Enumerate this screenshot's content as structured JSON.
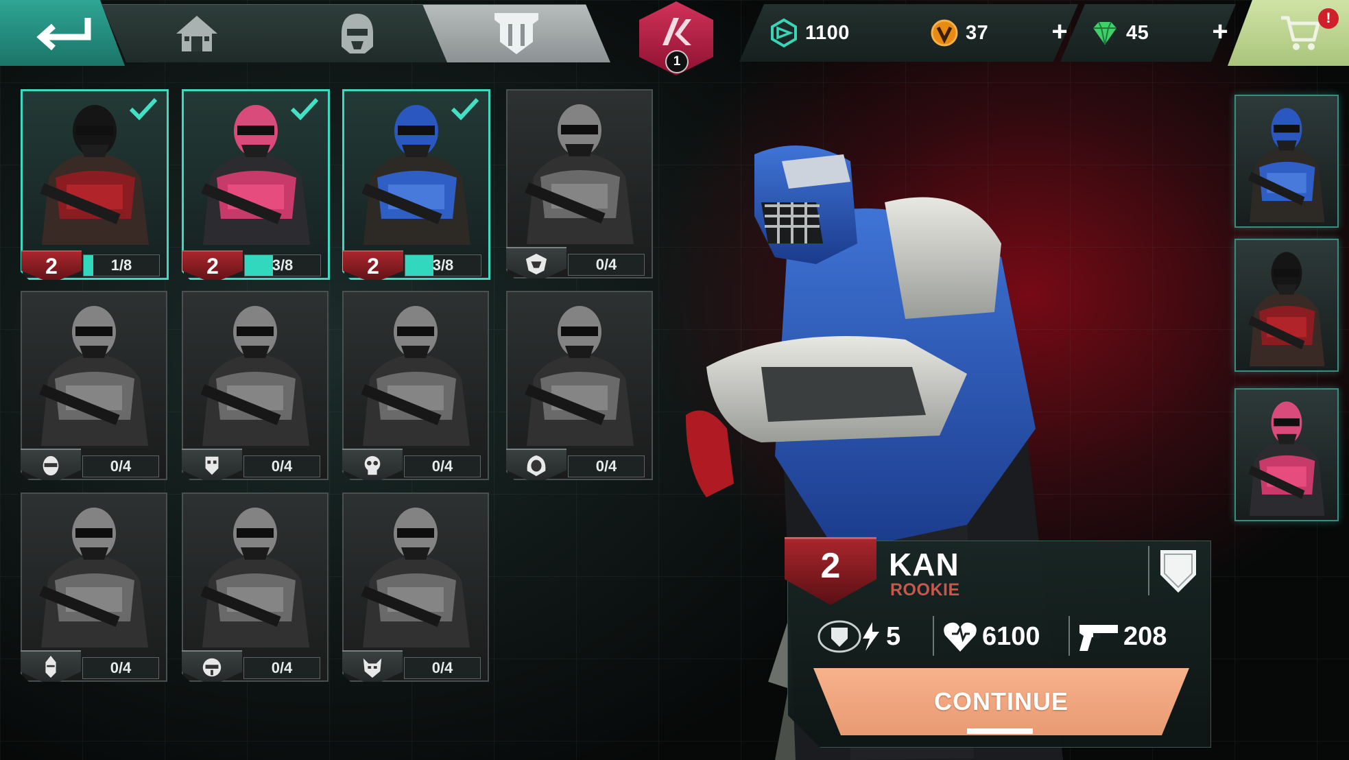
{
  "topbar": {
    "nav_tabs": [
      {
        "name": "home",
        "icon": "home-icon",
        "active": false
      },
      {
        "name": "heroes",
        "icon": "helmet-icon",
        "active": false
      },
      {
        "name": "gear",
        "icon": "armor-icon",
        "active": true
      }
    ],
    "rank": {
      "icon": "rank-emblem-icon",
      "level": "1"
    },
    "currencies": [
      {
        "icon": "credits-icon",
        "value": "1100",
        "color": "#38d6b7",
        "has_plus": false
      },
      {
        "icon": "gold-coin-icon",
        "value": "37",
        "color": "#e98b12",
        "has_plus": true
      },
      {
        "icon": "gem-icon",
        "value": "45",
        "color": "#3fd06a",
        "has_plus": true
      }
    ],
    "plus_label": "+",
    "cart": {
      "icon": "cart-icon",
      "alert": "!"
    }
  },
  "heroes": [
    {
      "status": "unlocked",
      "level": "2",
      "progress": "1/8",
      "fill": 0.125,
      "checked": true,
      "palette": "red"
    },
    {
      "status": "unlocked",
      "level": "2",
      "progress": "3/8",
      "fill": 0.375,
      "checked": true,
      "palette": "pink"
    },
    {
      "status": "unlocked",
      "level": "2",
      "progress": "3/8",
      "fill": 0.375,
      "checked": true,
      "palette": "blue"
    },
    {
      "status": "locked",
      "progress": "0/4",
      "fill": 0,
      "class_icon": "hood-class-icon"
    },
    {
      "status": "locked",
      "progress": "0/4",
      "fill": 0,
      "class_icon": "helmet-class-icon"
    },
    {
      "status": "locked",
      "progress": "0/4",
      "fill": 0,
      "class_icon": "mask-class-icon"
    },
    {
      "status": "locked",
      "progress": "0/4",
      "fill": 0,
      "class_icon": "skull-class-icon"
    },
    {
      "status": "locked",
      "progress": "0/4",
      "fill": 0,
      "class_icon": "hooded-class-icon"
    },
    {
      "status": "locked",
      "progress": "0/4",
      "fill": 0,
      "class_icon": "knight-class-icon"
    },
    {
      "status": "locked",
      "progress": "0/4",
      "fill": 0,
      "class_icon": "robot-class-icon"
    },
    {
      "status": "locked",
      "progress": "0/4",
      "fill": 0,
      "class_icon": "demon-class-icon"
    }
  ],
  "squad": [
    {
      "palette": "blue"
    },
    {
      "palette": "red"
    },
    {
      "palette": "pink"
    }
  ],
  "selected_hero": {
    "level": "2",
    "name": "KAN",
    "rank": "ROOKIE",
    "stats": [
      {
        "icon": "shield-power-icon",
        "value": "5"
      },
      {
        "icon": "heart-icon",
        "value": "6100"
      },
      {
        "icon": "gun-icon",
        "value": "208"
      }
    ],
    "continue_label": "CONTINUE"
  }
}
